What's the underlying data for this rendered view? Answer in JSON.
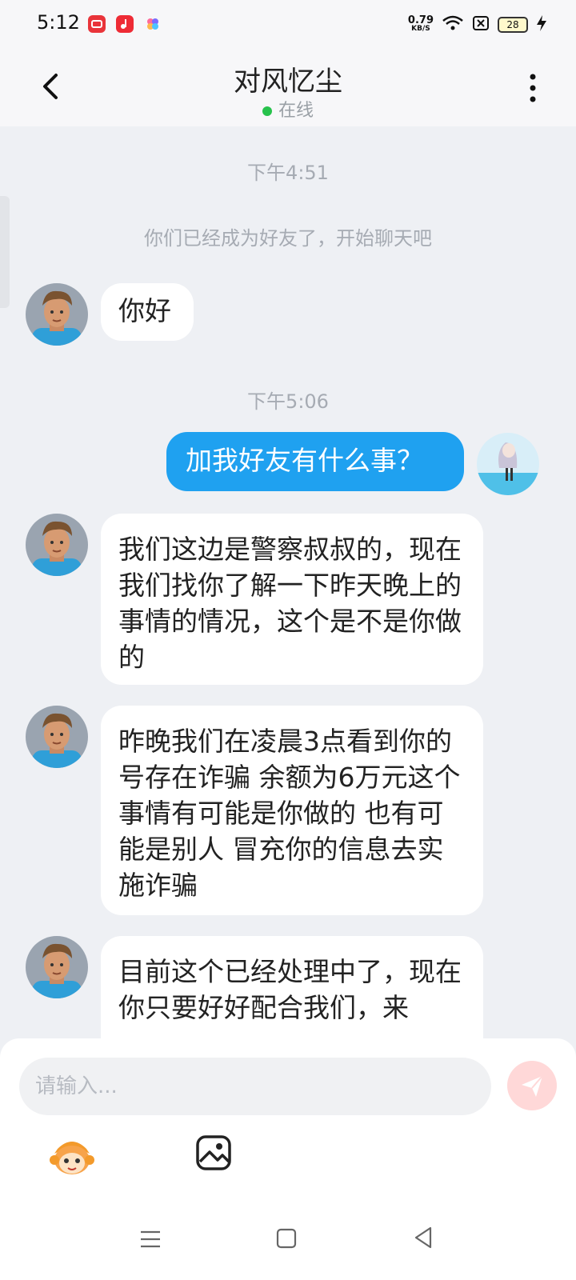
{
  "status_bar": {
    "time": "5:12",
    "net_speed_value": "0.79",
    "net_speed_unit": "KB/S",
    "battery": "28",
    "icons": [
      "screen-record-icon",
      "music-app-icon",
      "flower-app-icon",
      "wifi-icon",
      "sim-x-icon",
      "charging-icon"
    ]
  },
  "header": {
    "title": "对风忆尘",
    "status": "在线",
    "status_color": "#27c24c"
  },
  "chat": {
    "time1": "下午4:51",
    "system_msg": "你们已经成为好友了，开始聊天吧",
    "msg1": "你好",
    "time2": "下午5:06",
    "msg2": "加我好友有什么事？",
    "msg3": "我们这边是警察叔叔的，现在我们找你了解一下昨天晚上的事情的情况，这个是不是你做的",
    "msg4": "昨晚我们在凌晨3点看到你的号存在诈骗 余额为6万元这个事情有可能是你做的 也有可能是别人 冒充你的信息去实施诈骗",
    "msg5": "目前这个已经处理中了，现在你只要好好配合我们，来"
  },
  "input": {
    "placeholder": "请输入..."
  },
  "colors": {
    "outgoing_bubble": "#1fa1f0",
    "incoming_bubble": "#ffffff",
    "background": "#eef0f4",
    "send_button": "#ff8a8a"
  }
}
